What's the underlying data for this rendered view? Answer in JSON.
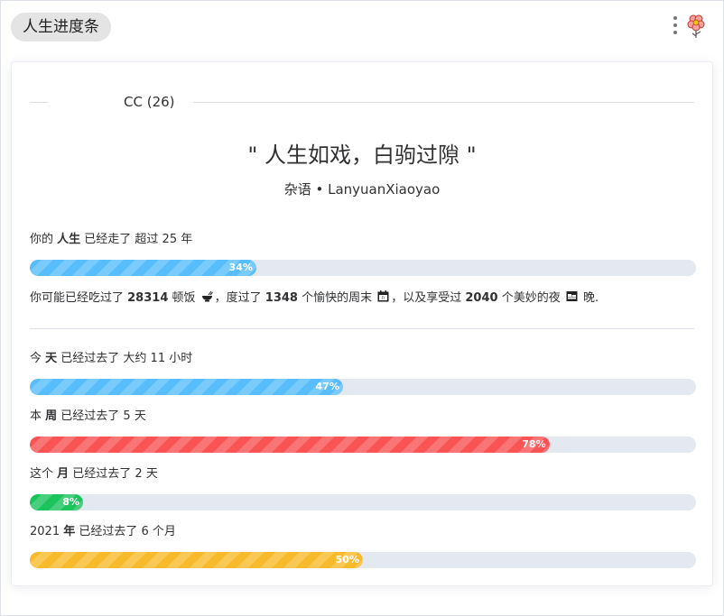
{
  "header": {
    "title": "人生进度条"
  },
  "card": {
    "divider_label": "CC (26)",
    "quote": "\" 人生如戏，白驹过隙 \"",
    "source": "杂语 • LanyuanXiaoyao"
  },
  "life": {
    "prefix": "你的 ",
    "bold": "人生",
    "suffix": " 已经走了 超过 25 年",
    "progress": 34,
    "percent_label": "34%",
    "color": "#58befb"
  },
  "stats": {
    "p1": "你可能已经吃过了 ",
    "meals": "28314",
    "p2": " 顿饭 ",
    "p3": "，度过了 ",
    "weekends": "1348",
    "p4": " 个愉快的周末 ",
    "p5": "，以及享受过 ",
    "nights": "2040",
    "p6": " 个美妙的夜 ",
    "p7": " 晚.",
    "icons": [
      "bowl-icon",
      "calendar-icon",
      "bed-icon"
    ]
  },
  "today": {
    "prefix": "今 ",
    "bold": "天",
    "suffix": " 已经过去了 大约 11 小时",
    "progress": 47,
    "percent_label": "47%",
    "color": "#58befb"
  },
  "week": {
    "prefix": "本 ",
    "bold": "周",
    "suffix": " 已经过去了 5 天",
    "progress": 78,
    "percent_label": "78%",
    "color": "#f95353"
  },
  "month": {
    "prefix": "这个 ",
    "bold": "月",
    "suffix": " 已经过去了 2 天",
    "progress": 8,
    "percent_label": "8%",
    "color": "#1ac35c"
  },
  "year": {
    "prefix": "2021 ",
    "bold": "年",
    "suffix": " 已经过去了 6 个月",
    "progress": 50,
    "percent_label": "50%",
    "color": "#f7ba2a"
  }
}
